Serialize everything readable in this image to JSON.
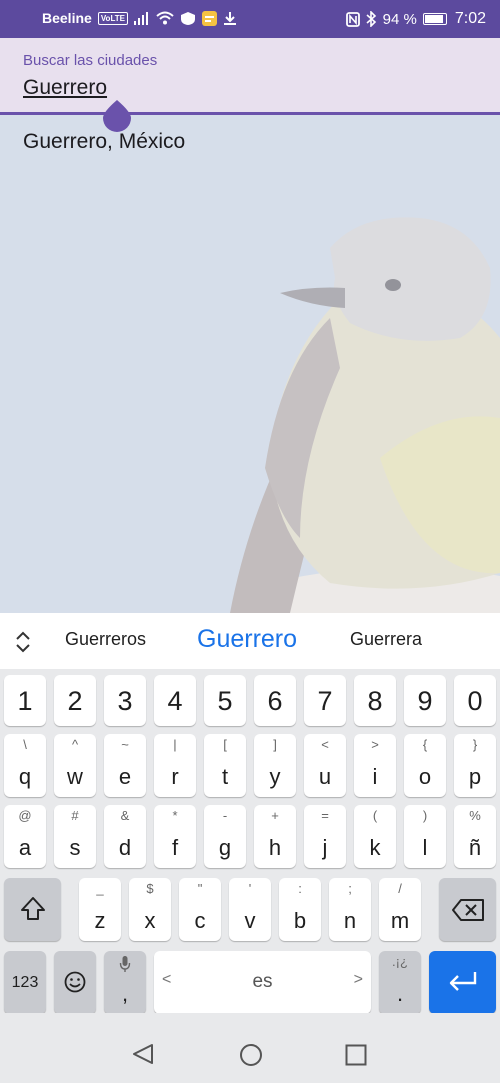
{
  "status_bar": {
    "carrier": "Beeline",
    "volte": "VoLTE",
    "battery": "94 %",
    "time": "7:02"
  },
  "search": {
    "label": "Buscar las ciudades",
    "value": "Guerrero"
  },
  "results": [
    {
      "label": "Guerrero, México"
    }
  ],
  "keyboard": {
    "suggestions": [
      "Guerreros",
      "Guerrero",
      "Guerrera"
    ],
    "number_row": [
      "1",
      "2",
      "3",
      "4",
      "5",
      "6",
      "7",
      "8",
      "9",
      "0"
    ],
    "row1": [
      {
        "sup": "\\",
        "main": "q"
      },
      {
        "sup": "^",
        "main": "w"
      },
      {
        "sup": "~",
        "main": "e"
      },
      {
        "sup": "|",
        "main": "r"
      },
      {
        "sup": "[",
        "main": "t"
      },
      {
        "sup": "]",
        "main": "y"
      },
      {
        "sup": "<",
        "main": "u"
      },
      {
        "sup": ">",
        "main": "i"
      },
      {
        "sup": "{",
        "main": "o"
      },
      {
        "sup": "}",
        "main": "p"
      }
    ],
    "row2": [
      {
        "sup": "@",
        "main": "a"
      },
      {
        "sup": "#",
        "main": "s"
      },
      {
        "sup": "&",
        "main": "d"
      },
      {
        "sup": "*",
        "main": "f"
      },
      {
        "sup": "-",
        "main": "g"
      },
      {
        "sup": "+",
        "main": "h"
      },
      {
        "sup": "=",
        "main": "j"
      },
      {
        "sup": "(",
        "main": "k"
      },
      {
        "sup": ")",
        "main": "l"
      },
      {
        "sup": "%",
        "main": "ñ"
      }
    ],
    "row3": [
      {
        "sup": "_",
        "main": "z"
      },
      {
        "sup": "$",
        "main": "x"
      },
      {
        "sup": "\"",
        "main": "c"
      },
      {
        "sup": "'",
        "main": "v"
      },
      {
        "sup": ":",
        "main": "b"
      },
      {
        "sup": ";",
        "main": "n"
      },
      {
        "sup": "/",
        "main": "m"
      }
    ],
    "symbols_key": "123",
    "comma_key": ",",
    "space_label": "es",
    "period_sup": ".¡¿",
    "period_key": ".",
    "space_left_arrow": "<",
    "space_right_arrow": ">"
  },
  "colors": {
    "accent": "#6a52ab",
    "status_bar": "#5c4a9e",
    "keyboard_blue": "#1a73e8"
  },
  "icons": [
    "signal-icon",
    "wifi-icon",
    "shield-icon",
    "message-icon",
    "download-icon",
    "nfc-icon",
    "bluetooth-icon",
    "battery-icon",
    "expand-icon",
    "shift-icon",
    "backspace-icon",
    "emoji-icon",
    "mic-icon",
    "enter-icon",
    "back-icon",
    "home-icon",
    "recents-icon"
  ]
}
